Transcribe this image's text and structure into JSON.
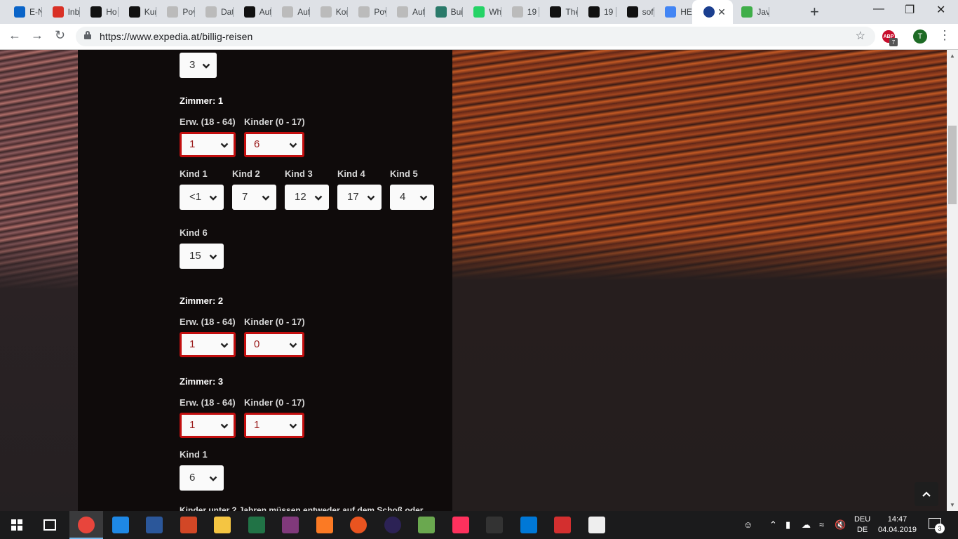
{
  "browser": {
    "tabs": [
      {
        "label": "E-N",
        "color": "#0a64c8"
      },
      {
        "label": "Inb",
        "color": "#d93025"
      },
      {
        "label": "Ho",
        "color": "#111111"
      },
      {
        "label": "Kur",
        "color": "#111111"
      },
      {
        "label": "Pov",
        "color": "#bbbbbb"
      },
      {
        "label": "Dat",
        "color": "#bbbbbb"
      },
      {
        "label": "Auf",
        "color": "#111111"
      },
      {
        "label": "Auf",
        "color": "#bbbbbb"
      },
      {
        "label": "Kor",
        "color": "#bbbbbb"
      },
      {
        "label": "Pov",
        "color": "#bbbbbb"
      },
      {
        "label": "Auf",
        "color": "#bbbbbb"
      },
      {
        "label": "Bui",
        "color": "#2a7a6a"
      },
      {
        "label": "Wh",
        "color": "#25d366"
      },
      {
        "label": "19",
        "color": "#bbbbbb"
      },
      {
        "label": "The",
        "color": "#111111"
      },
      {
        "label": "19",
        "color": "#111111"
      },
      {
        "label": "sof",
        "color": "#111111"
      },
      {
        "label": "HE",
        "color": "#4285f4"
      },
      {
        "label": "",
        "color": "#1b3f8f"
      },
      {
        "label": "Jav",
        "color": "#3fae49"
      }
    ],
    "url": "https://www.expedia.at/billig-reisen",
    "profile_initial": "T",
    "adblock_label": "ABP",
    "adblock_count": "7"
  },
  "form": {
    "prev_select_value": "3",
    "rooms": [
      {
        "title": "Zimmer: 1",
        "adults_label": "Erw. (18 - 64)",
        "children_label": "Kinder (0 - 17)",
        "adults": "1",
        "children": "6",
        "kids": [
          {
            "label": "Kind 1",
            "age": "<1"
          },
          {
            "label": "Kind 2",
            "age": "7"
          },
          {
            "label": "Kind 3",
            "age": "12"
          },
          {
            "label": "Kind 4",
            "age": "17"
          },
          {
            "label": "Kind 5",
            "age": "4"
          },
          {
            "label": "Kind 6",
            "age": "15"
          }
        ]
      },
      {
        "title": "Zimmer: 2",
        "adults_label": "Erw. (18 - 64)",
        "children_label": "Kinder (0 - 17)",
        "adults": "1",
        "children": "0",
        "kids": []
      },
      {
        "title": "Zimmer: 3",
        "adults_label": "Erw. (18 - 64)",
        "children_label": "Kinder (0 - 17)",
        "adults": "1",
        "children": "1",
        "kids": [
          {
            "label": "Kind 1",
            "age": "6"
          }
        ]
      }
    ],
    "note": "Kinder unter 2 Jahren müssen entweder auf dem Schoß oder"
  },
  "taskbar": {
    "language_top": "DEU",
    "language_bottom": "DE",
    "time": "14:47",
    "date": "04.04.2019",
    "notification_count": "3",
    "apps": [
      {
        "name": "chrome",
        "color": "#e8453c"
      },
      {
        "name": "edge",
        "color": "#1e88e5"
      },
      {
        "name": "word",
        "color": "#2b579a"
      },
      {
        "name": "powerpoint",
        "color": "#d24726"
      },
      {
        "name": "explorer",
        "color": "#f4c542"
      },
      {
        "name": "excel",
        "color": "#217346"
      },
      {
        "name": "onenote",
        "color": "#80397b"
      },
      {
        "name": "xampp",
        "color": "#fb7a24"
      },
      {
        "name": "ubuntu",
        "color": "#e95420"
      },
      {
        "name": "eclipse",
        "color": "#2c2255"
      },
      {
        "name": "app-green",
        "color": "#6aa84f"
      },
      {
        "name": "intellij",
        "color": "#fe315d"
      },
      {
        "name": "terminal",
        "color": "#333333"
      },
      {
        "name": "vscode",
        "color": "#0078d7"
      },
      {
        "name": "git",
        "color": "#d32f2f"
      },
      {
        "name": "photos",
        "color": "#eeeeee"
      }
    ]
  }
}
